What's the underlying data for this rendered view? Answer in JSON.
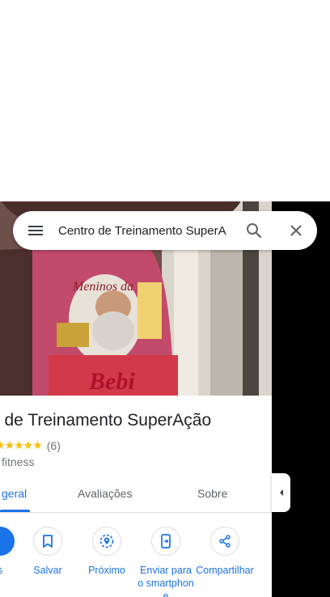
{
  "search": {
    "query": "Centro de Treinamento SuperA"
  },
  "place": {
    "name": "ro de Treinamento SuperAção",
    "stars": "★★★★★",
    "review_count": "(6)",
    "category": "fitness"
  },
  "tabs": [
    {
      "label": "geral",
      "active": true
    },
    {
      "label": "Avaliações",
      "active": false
    },
    {
      "label": "Sobre",
      "active": false
    }
  ],
  "actions": [
    {
      "label": "s",
      "icon": "directions-icon"
    },
    {
      "label": "Salvar",
      "icon": "bookmark-icon"
    },
    {
      "label": "Próximo",
      "icon": "nearby-icon"
    },
    {
      "label": "Enviar para o smartphone",
      "icon": "send-to-phone-icon"
    },
    {
      "label": "Compartilhar",
      "icon": "share-icon"
    }
  ],
  "colors": {
    "accent": "#1a73e8",
    "star": "#fbbc04",
    "text": "#202124",
    "secondary": "#70757a"
  }
}
